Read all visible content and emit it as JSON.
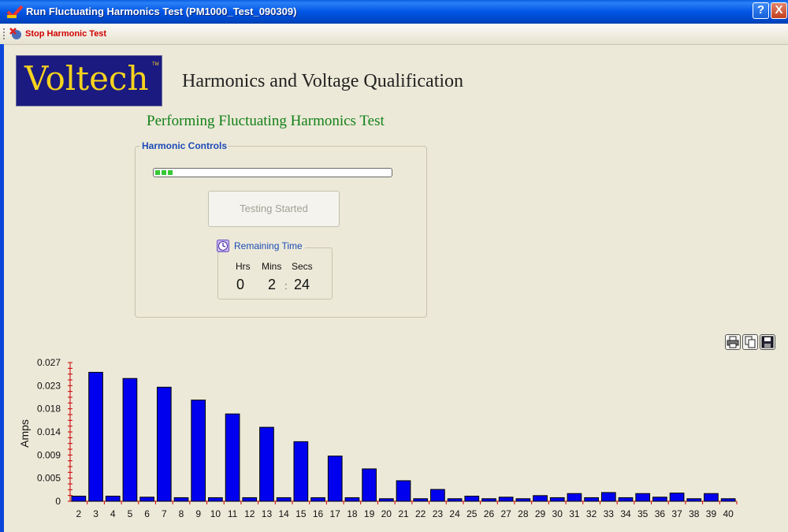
{
  "window": {
    "title": "Run Fluctuating Harmonics Test (PM1000_Test_090309)",
    "help_label": "?",
    "close_label": "X"
  },
  "toolbar": {
    "stop_label": "Stop Harmonic Test"
  },
  "header": {
    "logo_text": "Voltech",
    "logo_tm": "TM",
    "app_title": "Harmonics and Voltage Qualification"
  },
  "status": {
    "text": "Performing Fluctuating Harmonics Test"
  },
  "controls": {
    "group_label": "Harmonic Controls",
    "progress": 0.08,
    "testing_label": "Testing Started",
    "remaining": {
      "title": "Remaining Time",
      "hrs_label": "Hrs",
      "mins_label": "Mins",
      "secs_label": "Secs",
      "hrs": "0",
      "mins": "2",
      "sep": ":",
      "secs": "24"
    }
  },
  "chart_actions": [
    "print-icon",
    "copy-icon",
    "save-icon"
  ],
  "colors": {
    "bar": "#0000ee",
    "axis": "#cc0000",
    "status_green": "#138018",
    "legend_blue": "#1c4ab8"
  },
  "chart_data": {
    "type": "bar",
    "ylabel": "Amps",
    "ylim": [
      0,
      0.027
    ],
    "yticks": [
      "0",
      "0.005",
      "0.009",
      "0.014",
      "0.018",
      "0.023",
      "0.027"
    ],
    "categories": [
      "2",
      "3",
      "4",
      "5",
      "6",
      "7",
      "8",
      "9",
      "10",
      "11",
      "12",
      "13",
      "14",
      "15",
      "16",
      "17",
      "18",
      "19",
      "20",
      "21",
      "22",
      "23",
      "24",
      "25",
      "26",
      "27",
      "28",
      "29",
      "30",
      "31",
      "32",
      "33",
      "34",
      "35",
      "36",
      "37",
      "38",
      "39",
      "40"
    ],
    "values": [
      0.001,
      0.0251,
      0.001,
      0.0239,
      0.0008,
      0.0222,
      0.0007,
      0.0197,
      0.0007,
      0.017,
      0.0007,
      0.0144,
      0.0007,
      0.0116,
      0.0007,
      0.0088,
      0.0007,
      0.0063,
      0.0005,
      0.004,
      0.0005,
      0.0023,
      0.0005,
      0.001,
      0.0005,
      0.0008,
      0.0005,
      0.0011,
      0.0007,
      0.0015,
      0.0007,
      0.0017,
      0.0007,
      0.0015,
      0.0008,
      0.0016,
      0.0005,
      0.0015,
      0.0005
    ]
  }
}
